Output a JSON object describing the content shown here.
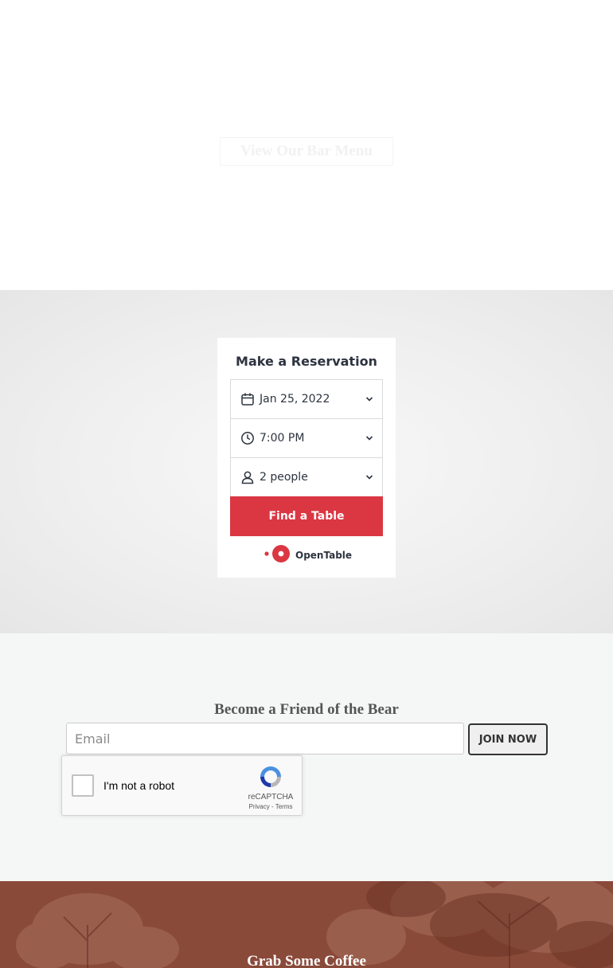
{
  "hero": {
    "menu_button_label": "View Our Bar Menu"
  },
  "reservation": {
    "title": "Make a Reservation",
    "date": "Jan 25, 2022",
    "time": "7:00 PM",
    "party_size": "2 people",
    "find_button_label": "Find a Table",
    "brand": "OpenTable",
    "brand_color": "#da3743"
  },
  "newsletter": {
    "title": "Become a Friend of the Bear",
    "email_placeholder": "Email",
    "join_button_label": "JOIN NOW",
    "recaptcha": {
      "label": "I'm not a robot",
      "brand": "reCAPTCHA",
      "privacy_link": "Privacy",
      "separator": "-",
      "terms_link": "Terms"
    }
  },
  "coffee": {
    "title": "Grab Some Coffee"
  },
  "icons": [
    "calendar-icon",
    "clock-icon",
    "person-icon",
    "chevron-down-icon",
    "opentable-logo-icon",
    "recaptcha-logo-icon"
  ]
}
